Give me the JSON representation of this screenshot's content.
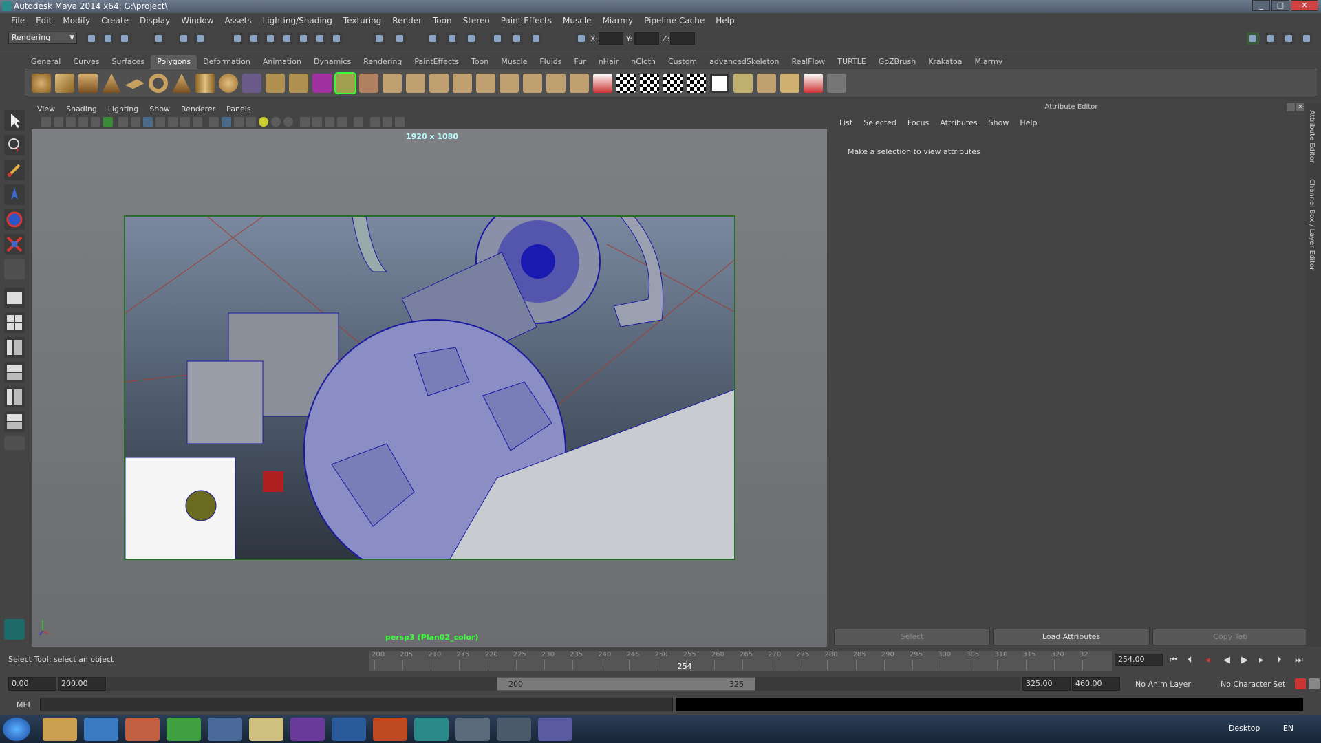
{
  "titlebar": {
    "title": "Autodesk Maya 2014 x64: G:\\project\\"
  },
  "menubar": [
    "File",
    "Edit",
    "Modify",
    "Create",
    "Display",
    "Window",
    "Assets",
    "Lighting/Shading",
    "Texturing",
    "Render",
    "Toon",
    "Stereo",
    "Paint Effects",
    "Muscle",
    "Miarmy",
    "Pipeline Cache",
    "Help"
  ],
  "statusline": {
    "mode": "Rendering",
    "x_label": "X:",
    "y_label": "Y:",
    "z_label": "Z:"
  },
  "shelf_tabs": [
    "General",
    "Curves",
    "Surfaces",
    "Polygons",
    "Deformation",
    "Animation",
    "Dynamics",
    "Rendering",
    "PaintEffects",
    "Toon",
    "Muscle",
    "Fluids",
    "Fur",
    "nHair",
    "nCloth",
    "Custom",
    "advancedSkeleton",
    "RealFlow",
    "TURTLE",
    "GoZBrush",
    "Krakatoa",
    "Miarmy"
  ],
  "shelf_active": "Polygons",
  "viewport": {
    "menu": [
      "View",
      "Shading",
      "Lighting",
      "Show",
      "Renderer",
      "Panels"
    ],
    "resolution": "1920 x 1080",
    "camera_label": "persp3 (Plan02_color)"
  },
  "attribute_editor": {
    "title": "Attribute Editor",
    "menu": [
      "List",
      "Selected",
      "Focus",
      "Attributes",
      "Show",
      "Help"
    ],
    "message": "Make a selection to view attributes",
    "buttons": {
      "select": "Select",
      "load": "Load Attributes",
      "copy": "Copy Tab"
    },
    "side_tabs": [
      "Attribute Editor",
      "Channel Box / Layer Editor"
    ]
  },
  "helpline": "Select Tool: select an object",
  "timeslider": {
    "ticks": [
      "200",
      "205",
      "210",
      "215",
      "220",
      "225",
      "230",
      "235",
      "240",
      "245",
      "250",
      "255",
      "260",
      "265",
      "270",
      "275",
      "280",
      "285",
      "290",
      "295",
      "300",
      "305",
      "310",
      "315",
      "320",
      "32"
    ],
    "current_marker": "254",
    "current_field": "254.00"
  },
  "range": {
    "start": "0.00",
    "playback_start": "200.00",
    "bar_start": "200",
    "bar_end": "325",
    "playback_end": "325.00",
    "end": "460.00",
    "anim_layer": "No Anim Layer",
    "char_set": "No Character Set"
  },
  "mel": {
    "label": "MEL"
  },
  "taskbar": {
    "desktop": "Desktop",
    "lang": "EN"
  },
  "colors": {
    "accent": "#2a8b8b",
    "viewport_bg": "#7d7f82",
    "wire": "#1a1aa0"
  }
}
